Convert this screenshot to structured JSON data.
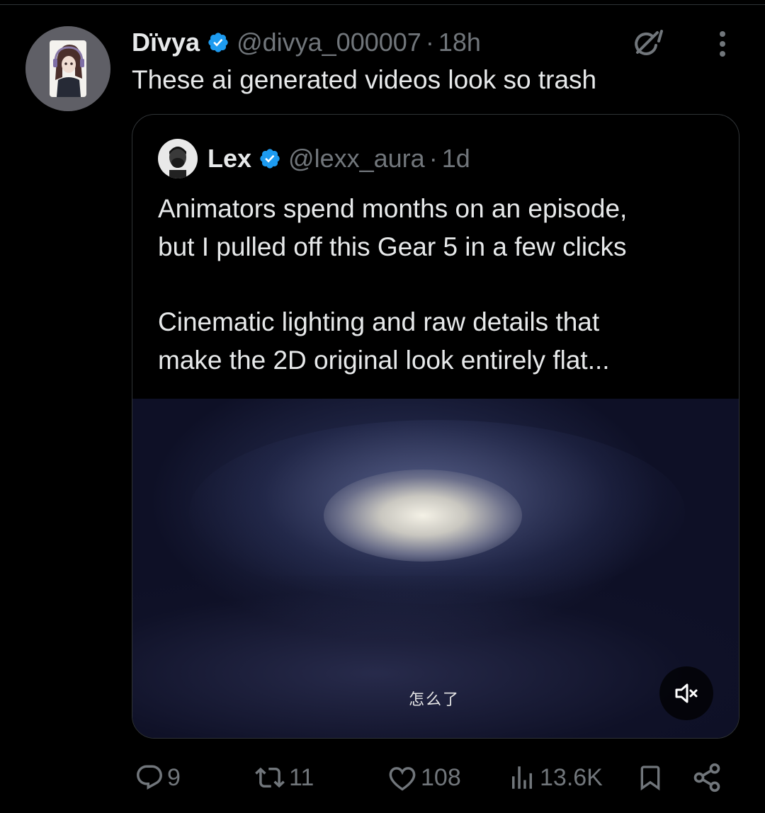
{
  "tweet": {
    "author_name": "Dïvya",
    "author_handle": "@divya_000007",
    "separator": "·",
    "time": "18h",
    "text": "These ai generated videos look so trash"
  },
  "quoted_tweet": {
    "author_name": "Lex",
    "author_handle": "@lexx_aura",
    "separator": "·",
    "time": "1d",
    "paragraph_1": "Animators spend months on an episode,\nbut I pulled off this Gear 5 in a few clicks",
    "paragraph_2": "Cinematic lighting and raw details that\nmake the 2D original look entirely flat...",
    "video": {
      "subtitle": "怎么了",
      "muted": true
    }
  },
  "actions": {
    "replies": "9",
    "reposts": "11",
    "likes": "108",
    "views": "13.6K"
  },
  "colors": {
    "background": "#000000",
    "text_primary": "#e7e9ea",
    "text_secondary": "#71767b",
    "verified_blue": "#1d9bf0",
    "border": "#2f3336"
  },
  "icons": [
    "verified-badge-icon",
    "grok-icon",
    "more-options-icon",
    "mute-icon",
    "reply-icon",
    "repost-icon",
    "like-icon",
    "views-icon",
    "bookmark-icon",
    "share-icon"
  ]
}
